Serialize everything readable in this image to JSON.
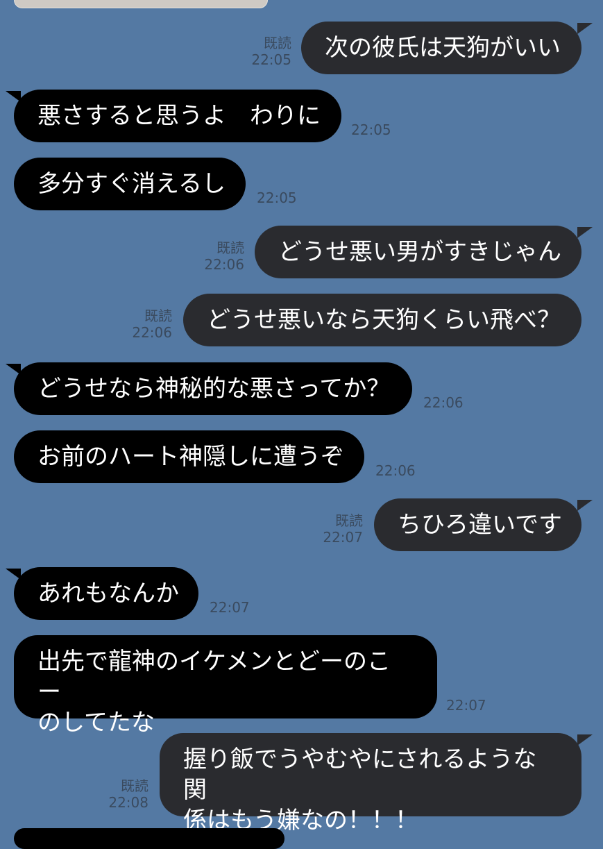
{
  "messages": [
    {
      "id": 1,
      "side": "out",
      "text": "次の彼氏は天狗がいい",
      "read": "既読",
      "time": "22:05"
    },
    {
      "id": 2,
      "side": "in",
      "text": "悪さすると思うよ　わりに",
      "time": "22:05"
    },
    {
      "id": 3,
      "side": "in",
      "text": "多分すぐ消えるし",
      "time": "22:05"
    },
    {
      "id": 4,
      "side": "out",
      "text": "どうせ悪い男がすきじゃん",
      "read": "既読",
      "time": "22:06"
    },
    {
      "id": 5,
      "side": "out",
      "text": "どうせ悪いなら天狗くらい飛べ？",
      "read": "既読",
      "time": "22:06"
    },
    {
      "id": 6,
      "side": "in",
      "text": "どうせなら神秘的な悪さってか？",
      "time": "22:06"
    },
    {
      "id": 7,
      "side": "in",
      "text": "お前のハート神隠しに遭うぞ",
      "time": "22:06"
    },
    {
      "id": 8,
      "side": "out",
      "text": "ちひろ違いです",
      "read": "既読",
      "time": "22:07"
    },
    {
      "id": 9,
      "side": "in",
      "text": "あれもなんか",
      "time": "22:07"
    },
    {
      "id": 10,
      "side": "in",
      "lines": [
        "出先で龍神のイケメンとどーのこー",
        "のしてたな"
      ],
      "time": "22:07"
    },
    {
      "id": 11,
      "side": "out",
      "lines": [
        "握り飯でうやむやにされるような関",
        "係はもう嫌なの！！！"
      ],
      "read": "既読",
      "time": "22:08"
    }
  ],
  "colors": {
    "background": "#5479a3",
    "incoming": "#000000",
    "outgoing": "#2a2b2f",
    "meta": "#3a4a5e"
  }
}
